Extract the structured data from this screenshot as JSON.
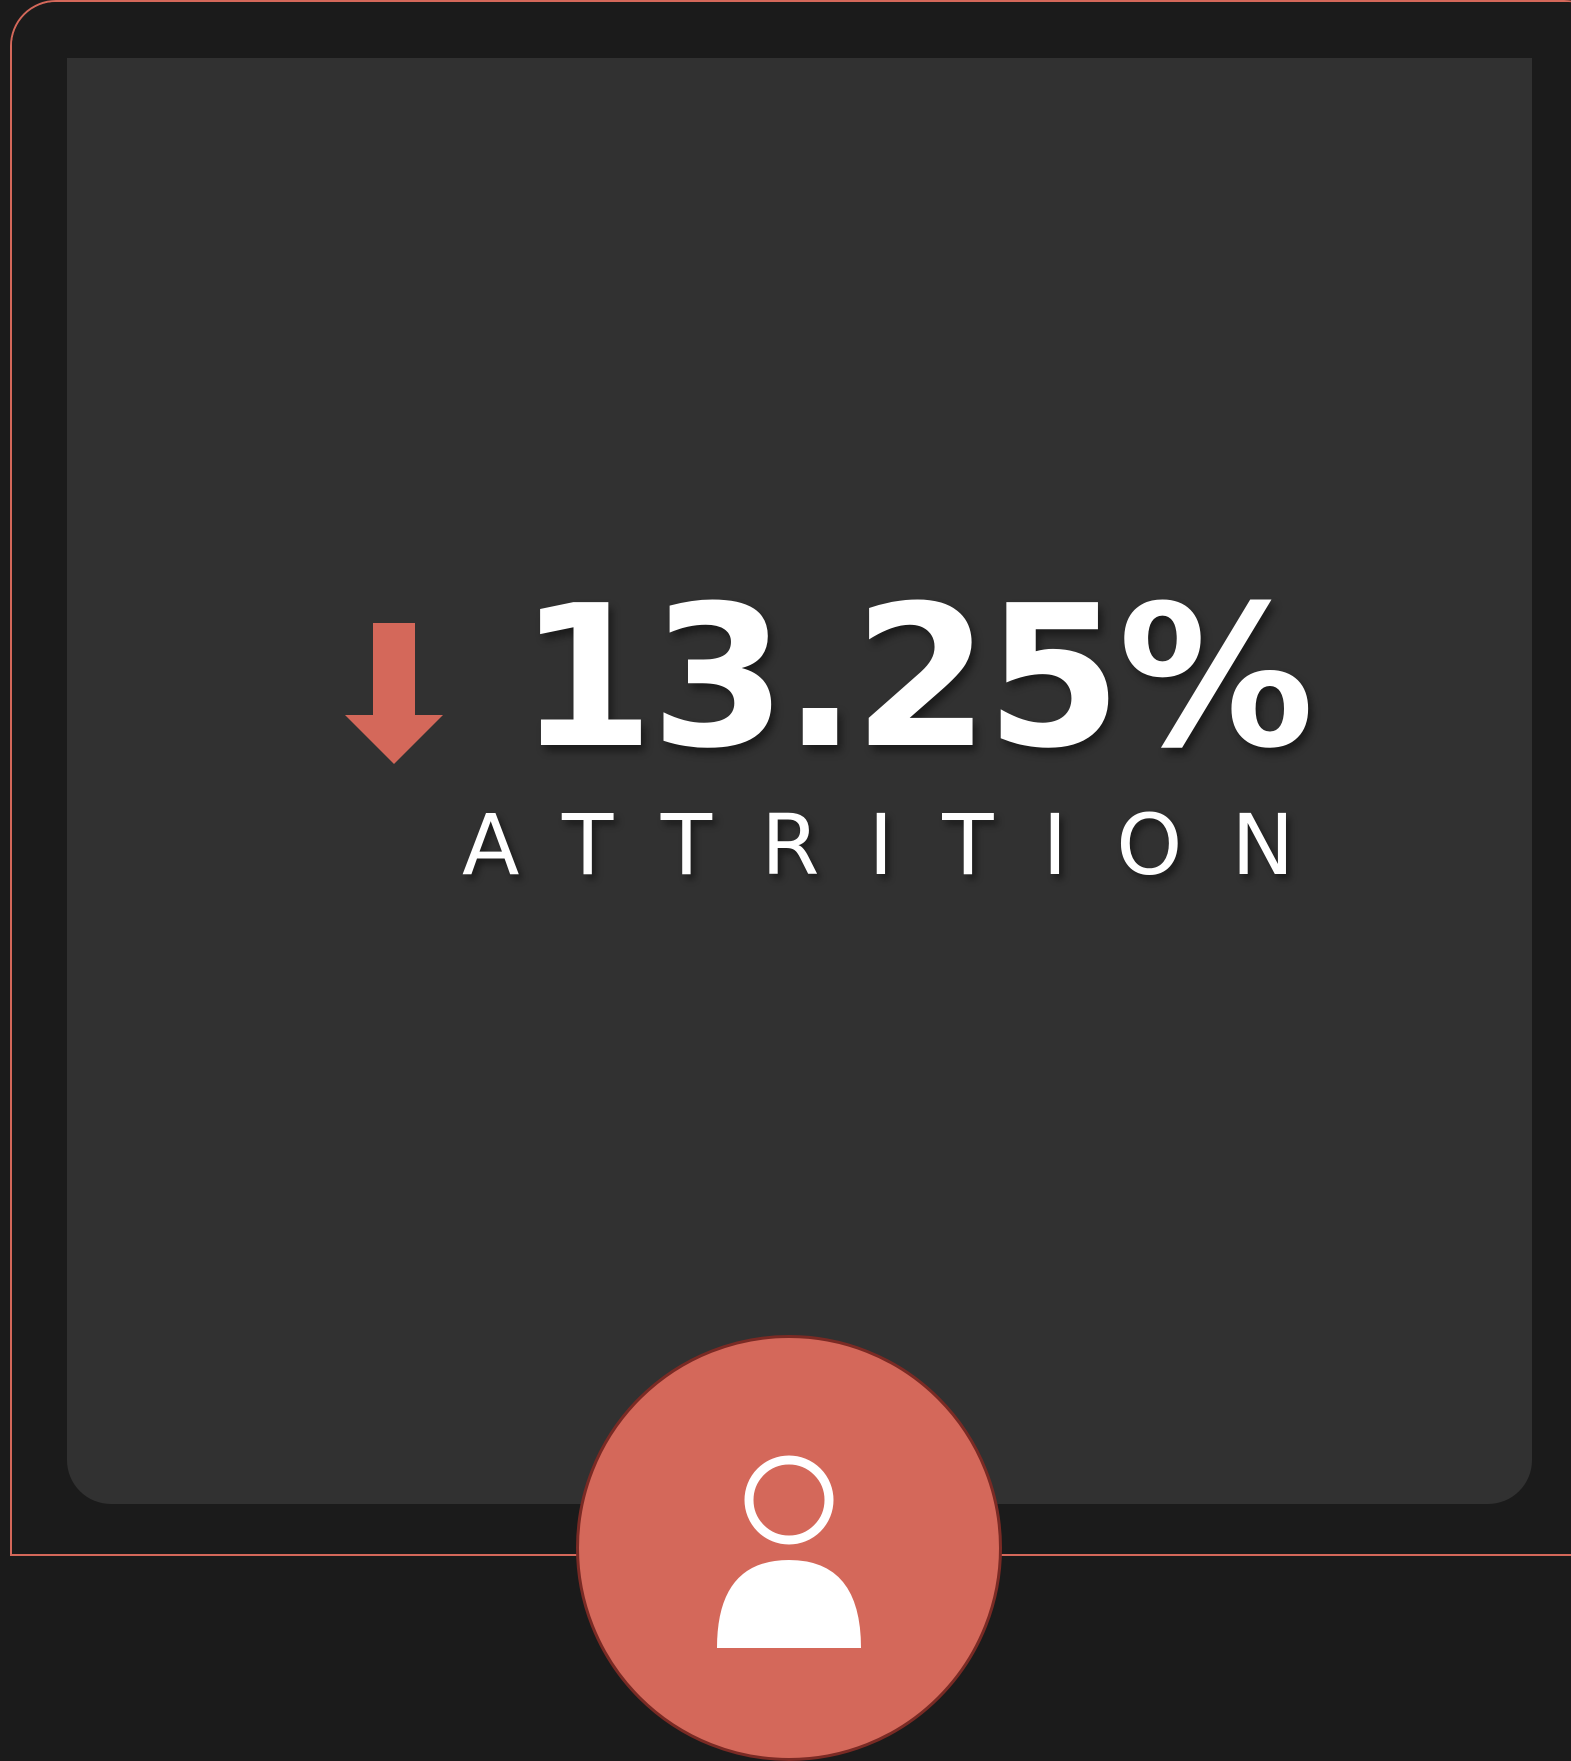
{
  "kpi": {
    "value": "13.25%",
    "label": "ATTRITION",
    "trend": "down",
    "trend_icon": "arrow-down-icon"
  },
  "badge": {
    "icon": "person-icon"
  },
  "colors": {
    "accent": "#d4685a",
    "card_background": "#313131",
    "frame_background": "#1b1b1b",
    "text": "#ffffff"
  }
}
